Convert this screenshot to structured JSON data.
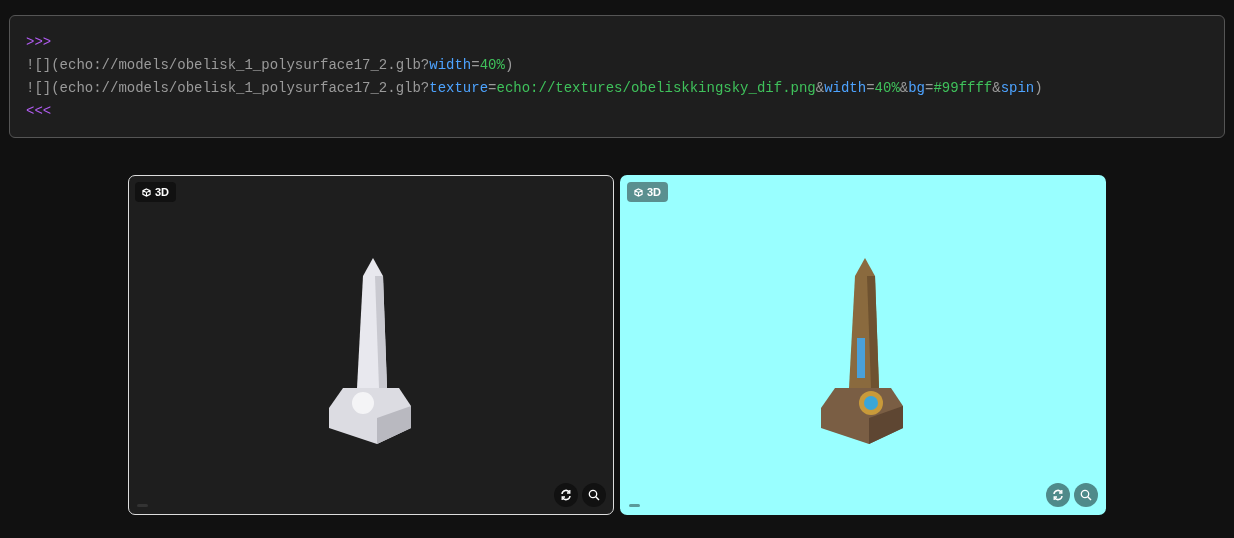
{
  "code_block": {
    "lines": [
      [
        {
          "kind": "delim",
          "text": ">>>"
        }
      ],
      [
        {
          "kind": "plain",
          "text": "![](echo://models/obelisk_1_polysurface17_2.glb?"
        },
        {
          "kind": "key",
          "text": "width"
        },
        {
          "kind": "plain",
          "text": "="
        },
        {
          "kind": "value",
          "text": "40%"
        },
        {
          "kind": "plain",
          "text": ")"
        }
      ],
      [
        {
          "kind": "plain",
          "text": "![](echo://models/obelisk_1_polysurface17_2.glb?"
        },
        {
          "kind": "key",
          "text": "texture"
        },
        {
          "kind": "plain",
          "text": "="
        },
        {
          "kind": "value",
          "text": "echo://textures/obeliskkingsky_dif.png"
        },
        {
          "kind": "plain",
          "text": "&"
        },
        {
          "kind": "key",
          "text": "width"
        },
        {
          "kind": "plain",
          "text": "="
        },
        {
          "kind": "value",
          "text": "40%"
        },
        {
          "kind": "plain",
          "text": "&"
        },
        {
          "kind": "key",
          "text": "bg"
        },
        {
          "kind": "plain",
          "text": "="
        },
        {
          "kind": "value",
          "text": "#99ffff"
        },
        {
          "kind": "plain",
          "text": "&"
        },
        {
          "kind": "key",
          "text": "spin"
        },
        {
          "kind": "plain",
          "text": ")"
        }
      ],
      [
        {
          "kind": "delim",
          "text": "<<<"
        }
      ]
    ]
  },
  "viewers": [
    {
      "badge": "3D",
      "selected": true,
      "color": "#1e1e1e",
      "textured": false
    },
    {
      "badge": "3D",
      "selected": false,
      "color": "#99ffff",
      "textured": true
    }
  ]
}
